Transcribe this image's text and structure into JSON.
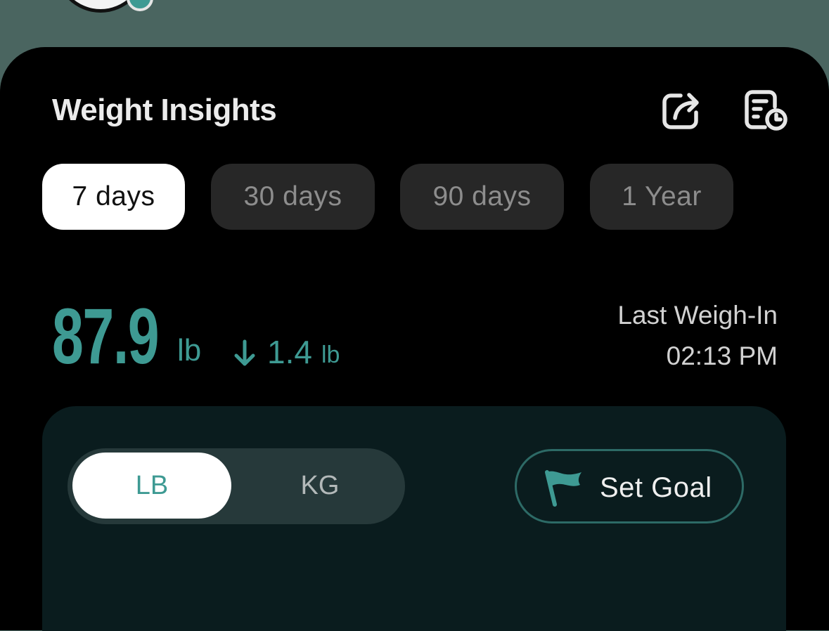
{
  "header": {
    "title": "Weight Insights",
    "share_icon": "share-icon",
    "report_icon": "report-history-icon"
  },
  "ranges": {
    "tabs": [
      {
        "label": "7 days",
        "active": true
      },
      {
        "label": "30 days",
        "active": false
      },
      {
        "label": "90 days",
        "active": false
      },
      {
        "label": "1 Year",
        "active": false
      }
    ]
  },
  "weight": {
    "value": "87.9",
    "unit": "lb",
    "change_value": "1.4",
    "change_unit": "lb",
    "change_direction": "down",
    "last_weighin_label": "Last Weigh-In",
    "last_weighin_time": "02:13 PM"
  },
  "units": {
    "options": [
      {
        "label": "LB",
        "active": true
      },
      {
        "label": "KG",
        "active": false
      }
    ]
  },
  "goal": {
    "label": "Set Goal",
    "icon": "flag-icon"
  },
  "colors": {
    "accent": "#3e9a93",
    "background": "#000000",
    "panel": "#0a1c1e"
  }
}
